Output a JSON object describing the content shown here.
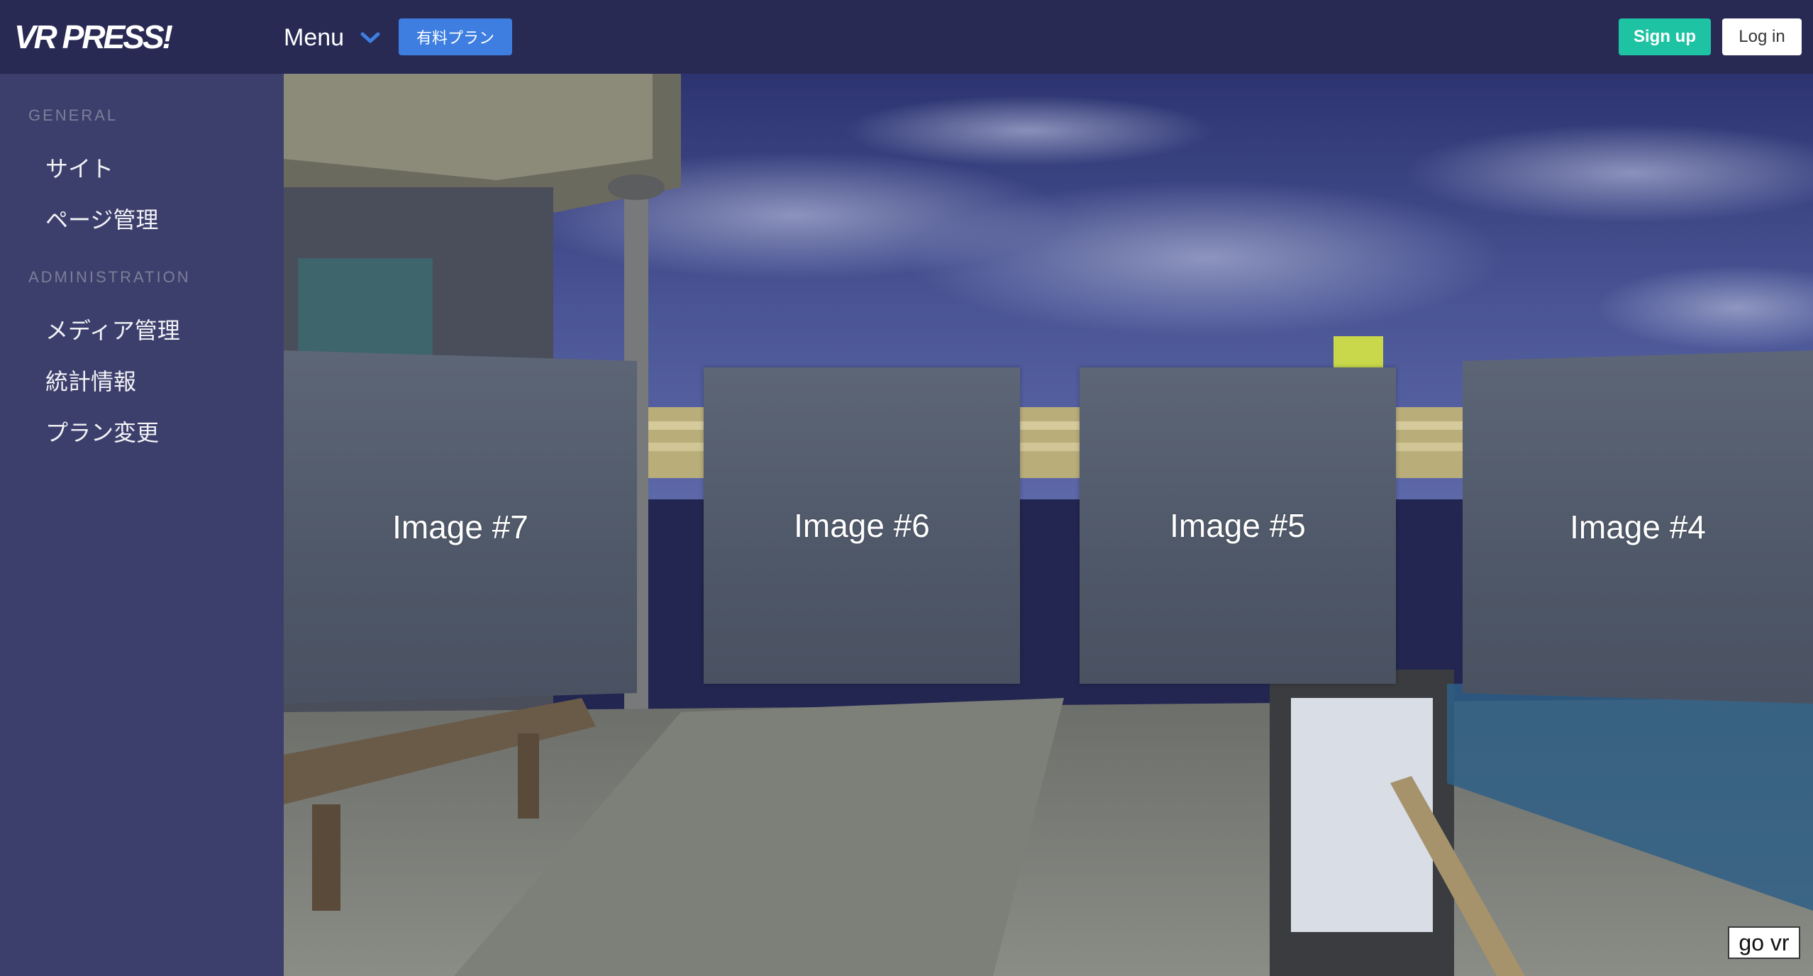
{
  "navbar": {
    "brand": "VR PRESS!",
    "menu_label": "Menu",
    "menu_icon": "chevron-down-icon",
    "plan_button": "有料プラン",
    "signup_button": "Sign up",
    "login_button": "Log in"
  },
  "sidebar": {
    "sections": [
      {
        "label": "GENERAL",
        "items": [
          "サイト",
          "ページ管理"
        ]
      },
      {
        "label": "ADMINISTRATION",
        "items": [
          "メディア管理",
          "統計情報",
          "プラン変更"
        ]
      }
    ]
  },
  "viewer": {
    "panels": [
      "Image #7",
      "Image #6",
      "Image #5",
      "Image #4"
    ],
    "go_vr_button": "go vr"
  },
  "colors": {
    "navbar_bg": "#282a54",
    "sidebar_bg": "#3c3f6b",
    "plan_button_bg": "#3d7ee0",
    "signup_button_bg": "#1ec3a4",
    "chevron_color": "#3d7ee0"
  }
}
